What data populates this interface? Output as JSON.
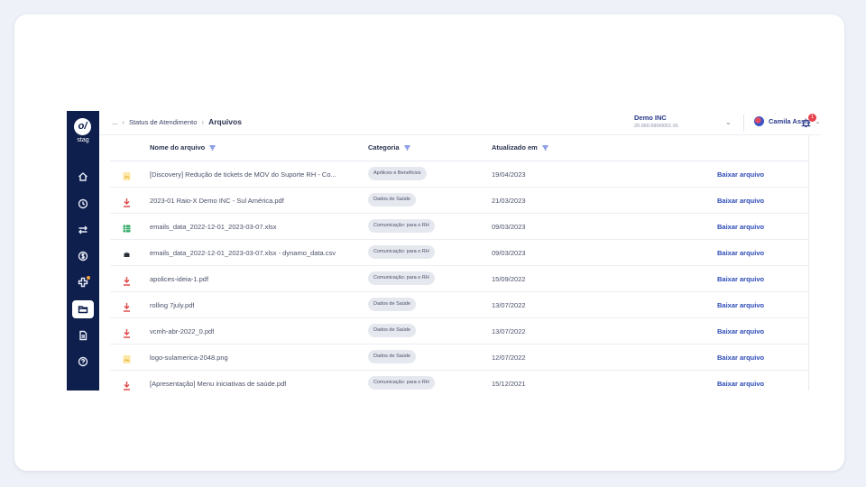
{
  "sidebar": {
    "logo_text": "o/",
    "brand": "stag",
    "items": [
      {
        "icon": "home-icon"
      },
      {
        "icon": "clock-icon"
      },
      {
        "icon": "transfer-icon"
      },
      {
        "icon": "dollar-icon"
      },
      {
        "icon": "health-cross-icon",
        "notification": true
      },
      {
        "icon": "folder-icon",
        "active": true
      },
      {
        "icon": "document-icon"
      },
      {
        "icon": "help-icon"
      }
    ]
  },
  "breadcrumb": {
    "ellipsis": "...",
    "parent": "Status de Atendimento",
    "current": "Arquivos"
  },
  "company": {
    "name": "Demo INC",
    "cnpj": "20.060.690/0001-91"
  },
  "user": {
    "name": "Camila Assis"
  },
  "notifications": {
    "count": "1"
  },
  "table": {
    "headers": {
      "name": "Nome do arquivo",
      "category": "Categoria",
      "updated": "Atualizado em"
    },
    "rows": [
      {
        "type": "image",
        "name": "[Discovery] Redução de tickets de MOV do Suporte RH - Co...",
        "category": "Apólices e Benefícios",
        "date": "19/04/2023",
        "action": "Baixar arquivo"
      },
      {
        "type": "pdf",
        "name": "2023-01 Raio-X Demo INC - Sul América.pdf",
        "category": "Dados de Saúde",
        "date": "21/03/2023",
        "action": "Baixar arquivo"
      },
      {
        "type": "xlsx",
        "name": "emails_data_2022-12-01_2023-03-07.xlsx",
        "category": "Comunicação: para o RH",
        "date": "09/03/2023",
        "action": "Baixar arquivo"
      },
      {
        "type": "csv",
        "name": "emails_data_2022-12-01_2023-03-07.xlsx - dynamo_data.csv",
        "category": "Comunicação: para o RH",
        "date": "09/03/2023",
        "action": "Baixar arquivo"
      },
      {
        "type": "pdf",
        "name": "apolices-ideia-1.pdf",
        "category": "Comunicação: para o RH",
        "date": "15/09/2022",
        "action": "Baixar arquivo"
      },
      {
        "type": "pdf",
        "name": "rolling 7july.pdf",
        "category": "Dados de Saúde",
        "date": "13/07/2022",
        "action": "Baixar arquivo"
      },
      {
        "type": "pdf",
        "name": "vcmh-abr-2022_0.pdf",
        "category": "Dados de Saúde",
        "date": "13/07/2022",
        "action": "Baixar arquivo"
      },
      {
        "type": "image",
        "name": "logo-sulamerica-2048.png",
        "category": "Dados de Saúde",
        "date": "12/07/2022",
        "action": "Baixar arquivo"
      },
      {
        "type": "pdf",
        "name": "[Apresentação] Menu iniciativas de saúde.pdf",
        "category": "Comunicação: para o RH",
        "date": "15/12/2021",
        "action": "Baixar arquivo"
      }
    ]
  },
  "colors": {
    "sidebar_bg": "#0e1e4d",
    "link": "#2d4bb7",
    "badge": "#e8434b"
  }
}
